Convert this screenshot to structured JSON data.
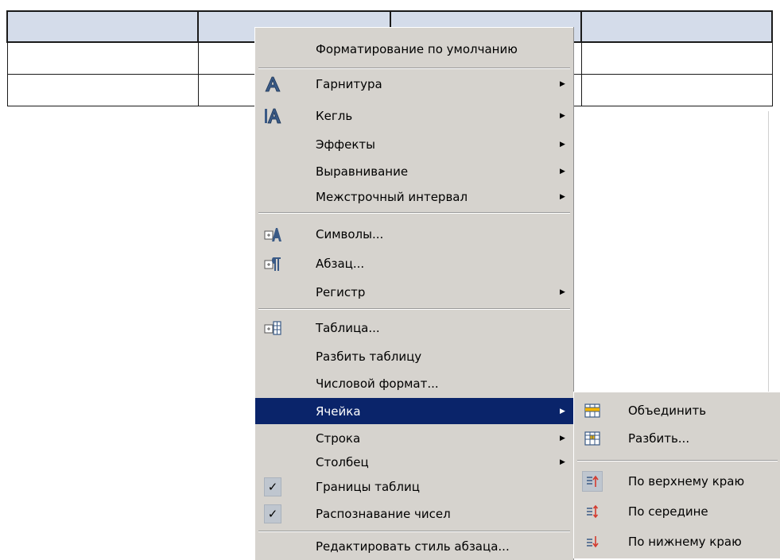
{
  "menu": {
    "items": [
      {
        "label": "Форматирование по умолчанию",
        "icon": null,
        "arrow": false
      },
      {
        "label": "Гарнитура",
        "icon": "font-name-icon",
        "arrow": true
      },
      {
        "label": "Кегль",
        "icon": "font-size-icon",
        "arrow": true
      },
      {
        "label": "Эффекты",
        "icon": null,
        "arrow": true
      },
      {
        "label": "Выравнивание",
        "icon": null,
        "arrow": true
      },
      {
        "label": "Межстрочный интервал",
        "icon": null,
        "arrow": true
      },
      {
        "label": "Символы...",
        "icon": "character-icon",
        "arrow": false
      },
      {
        "label": "Абзац...",
        "icon": "paragraph-icon",
        "arrow": false
      },
      {
        "label": "Регистр",
        "icon": null,
        "arrow": true
      },
      {
        "label": "Таблица...",
        "icon": "table-props-icon",
        "arrow": false
      },
      {
        "label": "Разбить таблицу",
        "icon": null,
        "arrow": false
      },
      {
        "label": "Числовой формат...",
        "icon": null,
        "arrow": false
      },
      {
        "label": "Ячейка",
        "icon": null,
        "arrow": true,
        "active": true
      },
      {
        "label": "Строка",
        "icon": null,
        "arrow": true
      },
      {
        "label": "Столбец",
        "icon": null,
        "arrow": true
      },
      {
        "label": "Границы таблиц",
        "icon": "check-icon",
        "checked": true
      },
      {
        "label": "Распознавание чисел",
        "icon": "check-icon",
        "checked": true
      },
      {
        "label": "Редактировать стиль абзаца...",
        "icon": null,
        "arrow": false
      }
    ],
    "arrow_glyph": "▶",
    "check_glyph": "✓"
  },
  "submenu": {
    "items": [
      {
        "label": "Объединить",
        "icon": "merge-cells-icon"
      },
      {
        "label": "Разбить...",
        "icon": "split-cells-icon"
      },
      {
        "label": "По верхнему краю",
        "icon": "align-top-icon",
        "pressed": true
      },
      {
        "label": "По середине",
        "icon": "align-middle-icon"
      },
      {
        "label": "По нижнему краю",
        "icon": "align-bottom-icon"
      }
    ]
  },
  "colors": {
    "menu_bg": "#d6d3ce",
    "highlight": "#0a246a",
    "table_header": "#d4dcea"
  }
}
